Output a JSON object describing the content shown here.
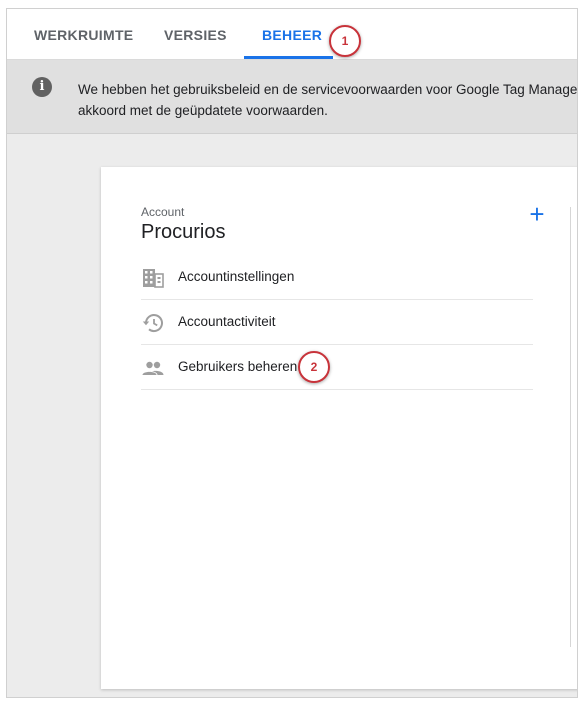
{
  "tabs": [
    {
      "label": "WERKRUIMTE",
      "active": false
    },
    {
      "label": "VERSIES",
      "active": false
    },
    {
      "label": "BEHEER",
      "active": true
    }
  ],
  "callouts": {
    "tab": "1",
    "users": "2"
  },
  "banner": {
    "icon": "info-icon",
    "line1": "We hebben het gebruiksbeleid en de servicevoorwaarden voor Google Tag Manager ge",
    "line2": "akkoord met de geüpdatete voorwaarden."
  },
  "account": {
    "section_label": "Account",
    "name": "Procurios",
    "add_icon": "plus-icon",
    "items": [
      {
        "label": "Accountinstellingen",
        "icon": "building-icon"
      },
      {
        "label": "Accountactiviteit",
        "icon": "history-icon"
      },
      {
        "label": "Gebruikers beheren",
        "icon": "people-icon"
      }
    ]
  },
  "colors": {
    "accent": "#1a73e8",
    "callout": "#c8333a",
    "banner_bg": "#e0e0e0",
    "page_bg": "#ececec"
  }
}
